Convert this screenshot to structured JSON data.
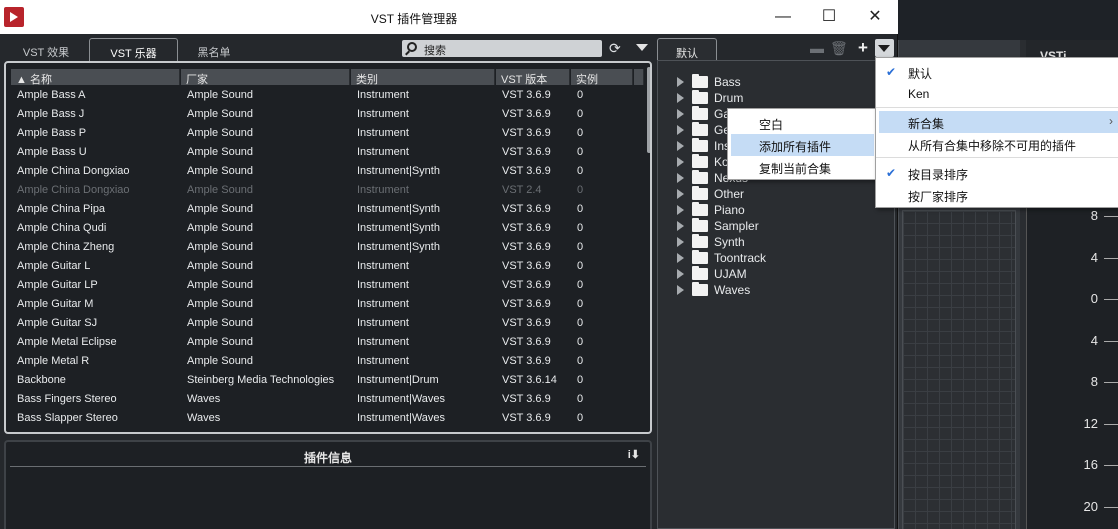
{
  "window": {
    "title": "VST 插件管理器",
    "minimize": "—",
    "maximize": "☐",
    "close": "✕"
  },
  "tabs": [
    {
      "label": "VST 效果"
    },
    {
      "label": "VST 乐器"
    },
    {
      "label": "黑名单"
    }
  ],
  "search": {
    "placeholder": "搜索"
  },
  "table": {
    "columns": [
      "▲ 名称",
      "厂家",
      "类别",
      "VST 版本",
      "实例"
    ],
    "rows": [
      {
        "name": "Ample Bass A",
        "vendor": "Ample Sound",
        "category": "Instrument",
        "version": "VST 3.6.9",
        "instances": "0",
        "disabled": false
      },
      {
        "name": "Ample Bass J",
        "vendor": "Ample Sound",
        "category": "Instrument",
        "version": "VST 3.6.9",
        "instances": "0",
        "disabled": false
      },
      {
        "name": "Ample Bass P",
        "vendor": "Ample Sound",
        "category": "Instrument",
        "version": "VST 3.6.9",
        "instances": "0",
        "disabled": false
      },
      {
        "name": "Ample Bass U",
        "vendor": "Ample Sound",
        "category": "Instrument",
        "version": "VST 3.6.9",
        "instances": "0",
        "disabled": false
      },
      {
        "name": "Ample China Dongxiao",
        "vendor": "Ample Sound",
        "category": "Instrument|Synth",
        "version": "VST 3.6.9",
        "instances": "0",
        "disabled": false
      },
      {
        "name": "Ample China Dongxiao",
        "vendor": "Ample Sound",
        "category": "Instrument",
        "version": "VST 2.4",
        "instances": "0",
        "disabled": true
      },
      {
        "name": "Ample China Pipa",
        "vendor": "Ample Sound",
        "category": "Instrument|Synth",
        "version": "VST 3.6.9",
        "instances": "0",
        "disabled": false
      },
      {
        "name": "Ample China Qudi",
        "vendor": "Ample Sound",
        "category": "Instrument|Synth",
        "version": "VST 3.6.9",
        "instances": "0",
        "disabled": false
      },
      {
        "name": "Ample China Zheng",
        "vendor": "Ample Sound",
        "category": "Instrument|Synth",
        "version": "VST 3.6.9",
        "instances": "0",
        "disabled": false
      },
      {
        "name": "Ample Guitar L",
        "vendor": "Ample Sound",
        "category": "Instrument",
        "version": "VST 3.6.9",
        "instances": "0",
        "disabled": false
      },
      {
        "name": "Ample Guitar LP",
        "vendor": "Ample Sound",
        "category": "Instrument",
        "version": "VST 3.6.9",
        "instances": "0",
        "disabled": false
      },
      {
        "name": "Ample Guitar M",
        "vendor": "Ample Sound",
        "category": "Instrument",
        "version": "VST 3.6.9",
        "instances": "0",
        "disabled": false
      },
      {
        "name": "Ample Guitar SJ",
        "vendor": "Ample Sound",
        "category": "Instrument",
        "version": "VST 3.6.9",
        "instances": "0",
        "disabled": false
      },
      {
        "name": "Ample Metal Eclipse",
        "vendor": "Ample Sound",
        "category": "Instrument",
        "version": "VST 3.6.9",
        "instances": "0",
        "disabled": false
      },
      {
        "name": "Ample Metal R",
        "vendor": "Ample Sound",
        "category": "Instrument",
        "version": "VST 3.6.9",
        "instances": "0",
        "disabled": false
      },
      {
        "name": "Backbone",
        "vendor": "Steinberg Media Technologies",
        "category": "Instrument|Drum",
        "version": "VST 3.6.14",
        "instances": "0",
        "disabled": false
      },
      {
        "name": "Bass Fingers Stereo",
        "vendor": "Waves",
        "category": "Instrument|Waves",
        "version": "VST 3.6.9",
        "instances": "0",
        "disabled": false
      },
      {
        "name": "Bass Slapper Stereo",
        "vendor": "Waves",
        "category": "Instrument|Waves",
        "version": "VST 3.6.9",
        "instances": "0",
        "disabled": false
      }
    ]
  },
  "info_panel": {
    "title": "插件信息",
    "icon_text": "i⬇"
  },
  "collections": {
    "tab_label": "默认",
    "plus": "+",
    "folders": [
      "Bass",
      "Drum",
      "Ga",
      "Ge",
      "Ins",
      "Ko",
      "Nexus",
      "Other",
      "Piano",
      "Sampler",
      "Synth",
      "Toontrack",
      "UJAM",
      "Waves"
    ]
  },
  "submenu": {
    "items": [
      {
        "label": "空白",
        "highlighted": false
      },
      {
        "label": "添加所有插件",
        "highlighted": true
      },
      {
        "label": "复制当前合集",
        "highlighted": false
      }
    ]
  },
  "main_menu": {
    "items": [
      {
        "label": "默认",
        "checked": true,
        "highlighted": false
      },
      {
        "label": "Ken",
        "checked": false,
        "highlighted": false
      },
      {
        "label": "新合集",
        "checked": false,
        "highlighted": true,
        "has_submenu": true
      },
      {
        "label": "从所有合集中移除不可用的插件",
        "checked": false,
        "highlighted": false
      },
      {
        "label": "按目录排序",
        "checked": true,
        "highlighted": false
      },
      {
        "label": "按厂家排序",
        "checked": false,
        "highlighted": false
      }
    ]
  },
  "background": {
    "top_label": "VSTi",
    "scale_ticks": [
      "8",
      "4",
      "0",
      "4",
      "8",
      "12",
      "16",
      "20"
    ]
  },
  "colors": {
    "accent_highlight": "#c5dcf5",
    "app_logo": "#b8242b",
    "check": "#2a6fd6"
  }
}
